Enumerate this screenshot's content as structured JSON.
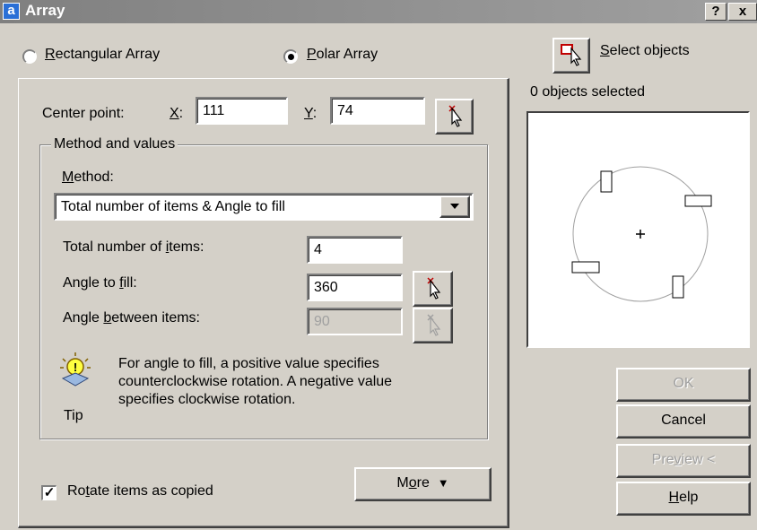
{
  "window": {
    "app_icon": "a",
    "title": "Array",
    "help_btn": "?",
    "close_btn": "x"
  },
  "mode": {
    "rect_pre": "",
    "rect_key": "R",
    "rect_post": "ectangular Array",
    "polar_pre": "",
    "polar_key": "P",
    "polar_post": "olar Array",
    "selected": "polar"
  },
  "select": {
    "pre": "",
    "key": "S",
    "post": "elect objects",
    "status": "0 objects selected"
  },
  "center": {
    "label": "Center point:",
    "x_key": "X",
    "x_post": ":",
    "x_value": "111",
    "y_key": "Y",
    "y_post": ":",
    "y_value": "74"
  },
  "method_group": {
    "title": "Method and values",
    "method_key": "M",
    "method_post": "ethod:",
    "method_value": "Total number of items & Angle to fill",
    "items_pre": "Total number of ",
    "items_key": "i",
    "items_post": "tems:",
    "items_value": "4",
    "angle_pre": "Angle to ",
    "angle_key": "f",
    "angle_post": "ill:",
    "angle_value": "360",
    "between_pre": "Angle ",
    "between_key": "b",
    "between_post": "etween items:",
    "between_value": "90"
  },
  "tip": {
    "label": "Tip",
    "line1": "For angle to fill, a positive value specifies",
    "line2": "counterclockwise rotation.  A negative value",
    "line3": "specifies clockwise rotation."
  },
  "rotate": {
    "pre": "Ro",
    "key": "t",
    "post": "ate items as copied",
    "checked": true,
    "check_glyph": "✓"
  },
  "buttons": {
    "more_pre": "M",
    "more_key": "o",
    "more_post": "re",
    "more_arrow": "▼",
    "ok": "OK",
    "cancel": "Cancel",
    "preview_pre": "Pre",
    "preview_key": "v",
    "preview_post": "iew <",
    "help_key": "H",
    "help_post": "elp"
  },
  "icons": {
    "pick_point": "pick-point-icon",
    "select_objects": "select-objects-icon",
    "tip": "lightbulb-icon",
    "dropdown": "chevron-down-icon"
  }
}
